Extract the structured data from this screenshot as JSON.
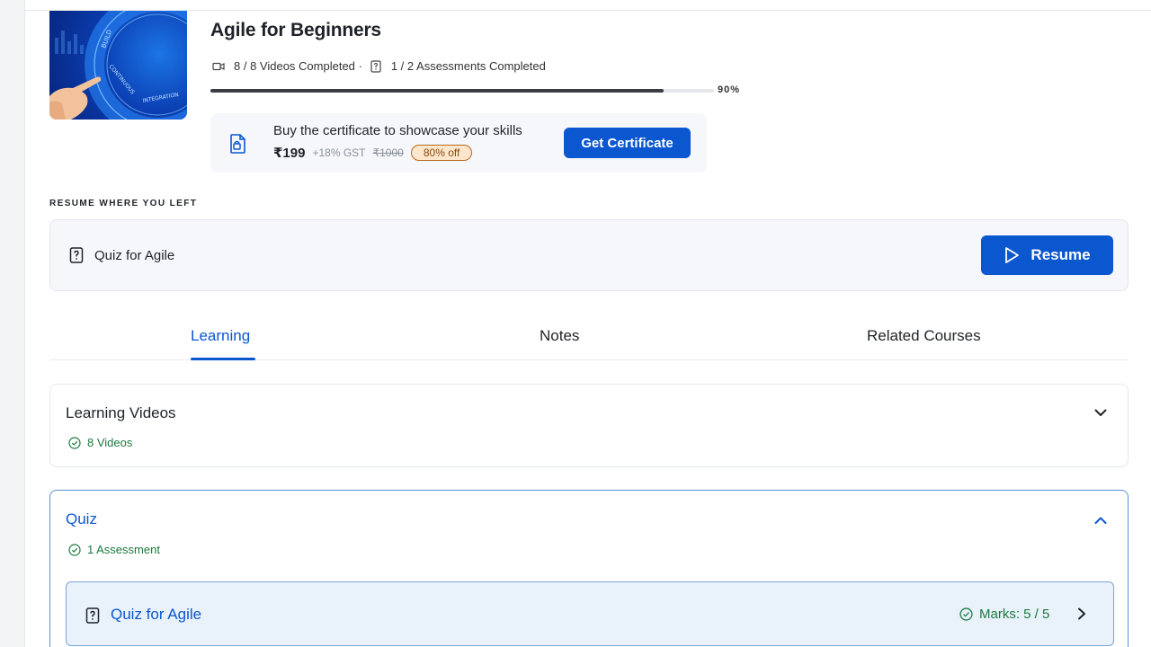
{
  "course": {
    "title": "Agile for Beginners",
    "videos_completed": "8 / 8 Videos Completed ·",
    "assessments_completed": "1 / 2 Assessments Completed",
    "progress_label": "90%",
    "progress_value": 0.9,
    "thumbnail_words": [
      "BUILD",
      "CONTINUOUS",
      "INTEGRATION"
    ]
  },
  "certificate": {
    "text": "Buy the certificate to showcase your skills",
    "price": "₹199",
    "gst": "+18% GST",
    "old_price": "₹1000",
    "discount": "80% off",
    "button": "Get Certificate"
  },
  "resume": {
    "section_label": "RESUME WHERE YOU LEFT",
    "item": "Quiz for Agile",
    "button": "Resume"
  },
  "tabs": [
    {
      "label": "Learning",
      "active": true
    },
    {
      "label": "Notes",
      "active": false
    },
    {
      "label": "Related Courses",
      "active": false
    }
  ],
  "sections": [
    {
      "title": "Learning Videos",
      "subtitle": "8 Videos",
      "expanded": false
    },
    {
      "title": "Quiz",
      "subtitle": "1 Assessment",
      "expanded": true,
      "items": [
        {
          "title": "Quiz for Agile",
          "marks": "Marks: 5 / 5"
        }
      ]
    }
  ],
  "colors": {
    "accent": "#0b57d0",
    "success": "#1b7a3e",
    "discount_bg": "#fde7cc",
    "card_bg": "#f5f7fb"
  },
  "icons": {
    "video": "video-camera-icon",
    "assessment": "question-doc-icon",
    "certificate": "certificate-doc-icon",
    "play": "play-icon",
    "check": "check-circle-icon",
    "collapse": "chevron-down-icon",
    "expand": "chevron-up-icon",
    "open": "chevron-right-icon"
  }
}
